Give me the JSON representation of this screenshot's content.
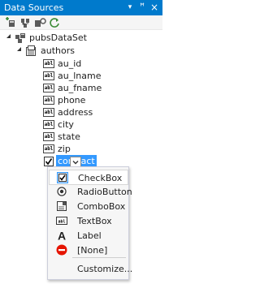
{
  "title": "Data Sources",
  "title_buttons": {
    "dropdown": "▾",
    "pin": "ꟸ",
    "close": "×"
  },
  "tree": {
    "dataset": "pubsDataSet",
    "table": "authors",
    "fields": [
      {
        "name": "au_id",
        "icon": "field-text-icon",
        "glyph": "abl"
      },
      {
        "name": "au_lname",
        "icon": "field-text-icon",
        "glyph": "abl"
      },
      {
        "name": "au_fname",
        "icon": "field-text-icon",
        "glyph": "abl"
      },
      {
        "name": "phone",
        "icon": "field-text-icon",
        "glyph": "abl"
      },
      {
        "name": "address",
        "icon": "field-text-icon",
        "glyph": "abl"
      },
      {
        "name": "city",
        "icon": "field-text-icon",
        "glyph": "abl"
      },
      {
        "name": "state",
        "icon": "field-text-icon",
        "glyph": "abl"
      },
      {
        "name": "zip",
        "icon": "field-text-icon",
        "glyph": "abl"
      }
    ],
    "selected_field": "contract"
  },
  "menu": {
    "items": [
      {
        "label": "CheckBox",
        "icon": "checkbox-icon",
        "checked": true
      },
      {
        "label": "RadioButton",
        "icon": "radio-icon",
        "checked": false
      },
      {
        "label": "ComboBox",
        "icon": "combobox-icon",
        "checked": false
      },
      {
        "label": "TextBox",
        "icon": "textbox-icon",
        "checked": false
      },
      {
        "label": "Label",
        "icon": "label-icon",
        "checked": false
      },
      {
        "label": "[None]",
        "icon": "none-icon",
        "checked": false
      }
    ],
    "customize": "Customize..."
  },
  "colors": {
    "accent": "#007acc",
    "selection": "#3399ff",
    "none_red": "#e51400"
  }
}
